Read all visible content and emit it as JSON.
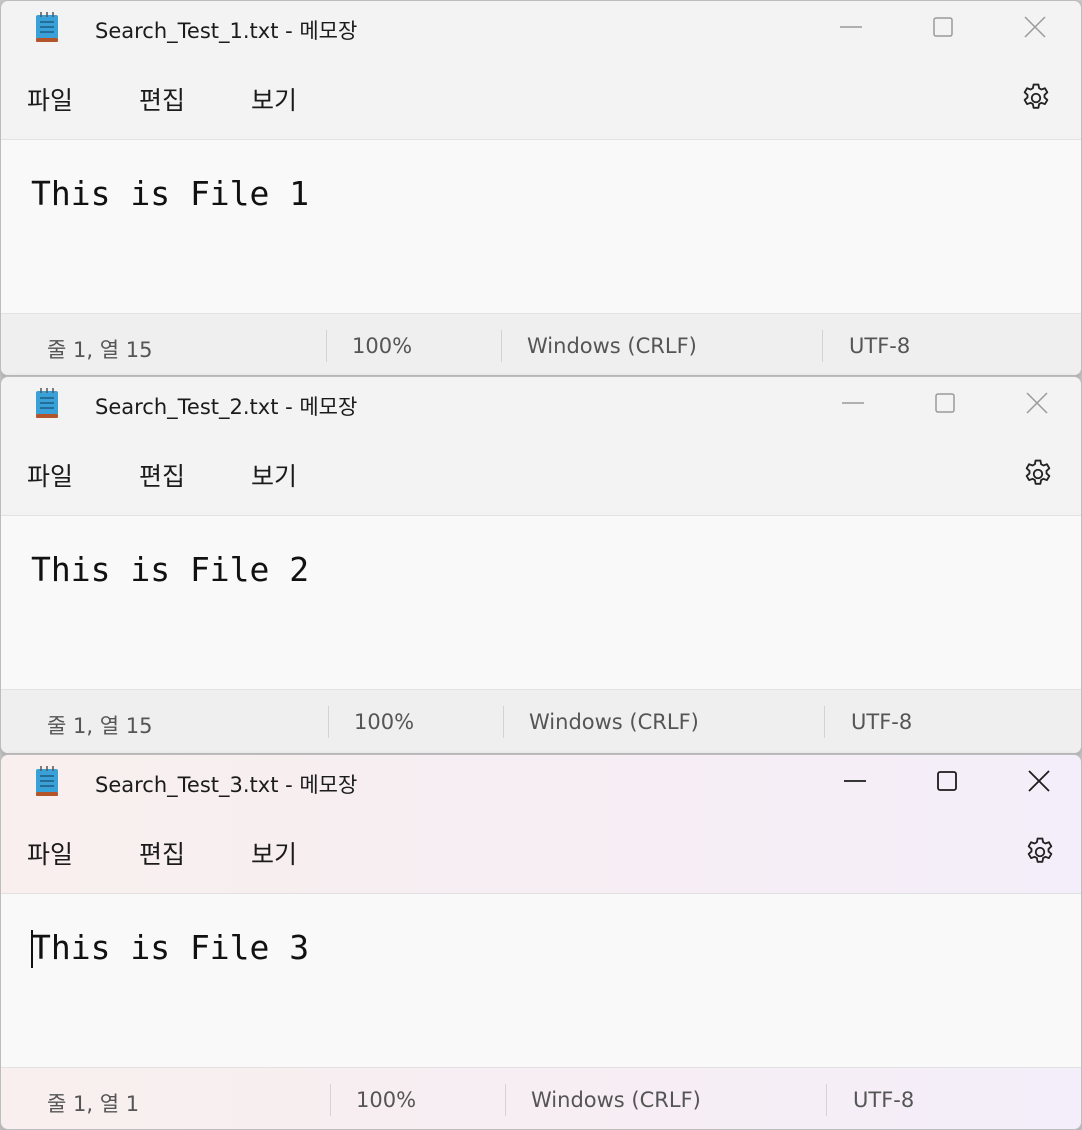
{
  "windows": [
    {
      "title": "Search_Test_1.txt - 메모장",
      "menu": [
        "파일",
        "편집",
        "보기"
      ],
      "content": "This is File 1",
      "status": {
        "position": "줄 1, 열 15",
        "zoom": "100%",
        "line_ending": "Windows (CRLF)",
        "encoding": "UTF-8"
      },
      "focused": false
    },
    {
      "title": "Search_Test_2.txt - 메모장",
      "menu": [
        "파일",
        "편집",
        "보기"
      ],
      "content": "This is File 2",
      "status": {
        "position": "줄 1, 열 15",
        "zoom": "100%",
        "line_ending": "Windows (CRLF)",
        "encoding": "UTF-8"
      },
      "focused": false
    },
    {
      "title": "Search_Test_3.txt - 메모장",
      "menu": [
        "파일",
        "편집",
        "보기"
      ],
      "content": "This is File 3",
      "status": {
        "position": "줄 1, 열 1",
        "zoom": "100%",
        "line_ending": "Windows (CRLF)",
        "encoding": "UTF-8"
      },
      "focused": true
    }
  ],
  "icons": {
    "app": "notepad-icon",
    "minimize": "minimize-icon",
    "maximize": "maximize-icon",
    "close": "close-icon",
    "settings": "gear-icon"
  },
  "colors": {
    "inactive_caption": "#9a9a9a",
    "active_caption": "#1b1b1b",
    "notepad_icon_blue": "#3aa0d8",
    "notepad_icon_base": "#b4542a"
  }
}
